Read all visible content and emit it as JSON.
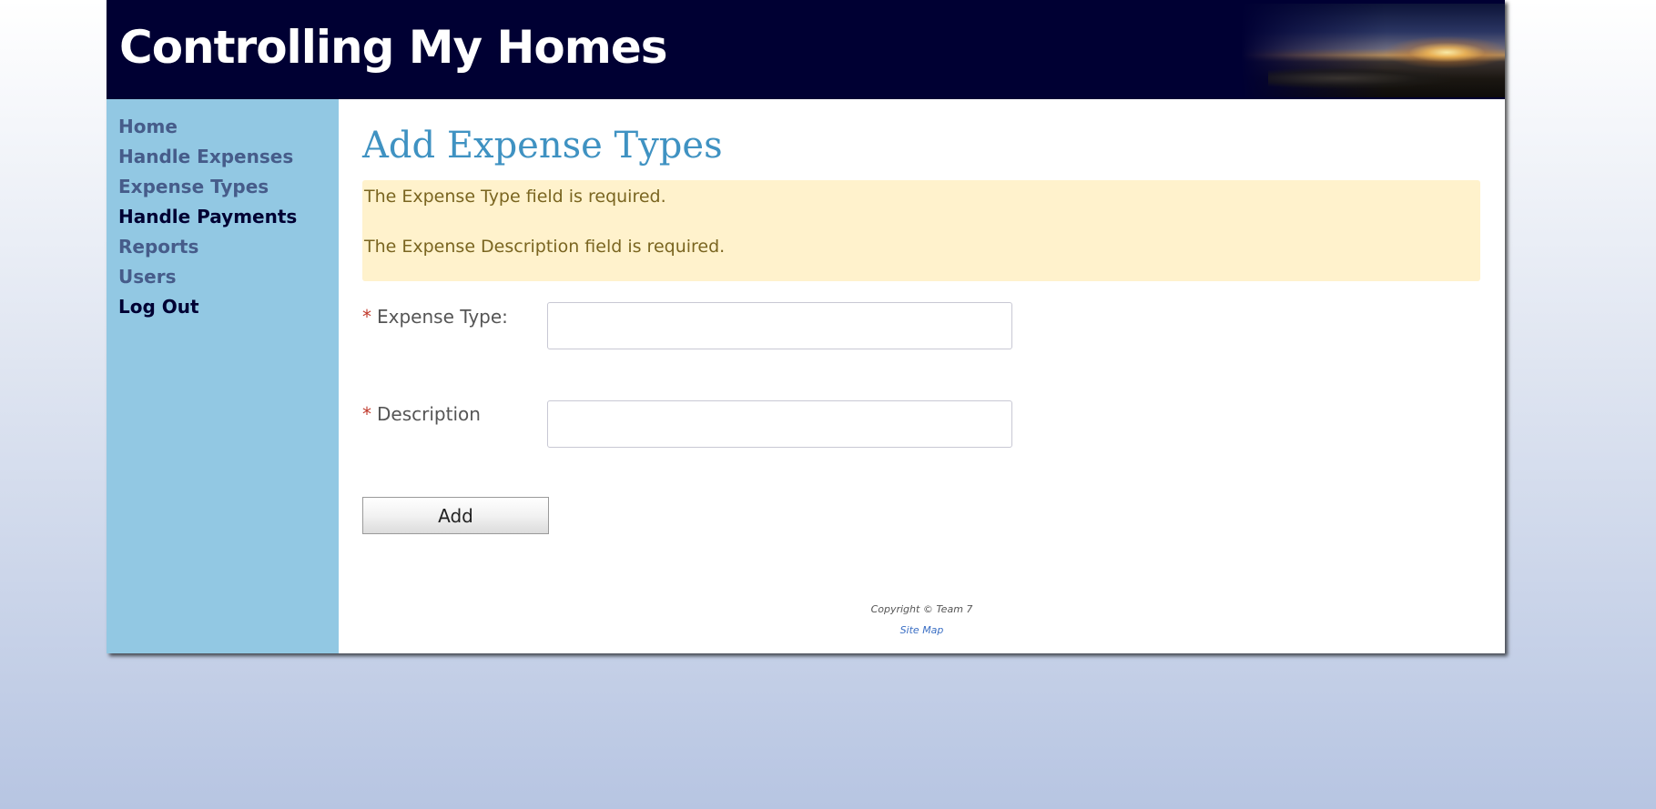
{
  "header": {
    "title": "Controlling My Homes"
  },
  "sidebar": {
    "items": [
      {
        "label": "Home"
      },
      {
        "label": "Handle Expenses"
      },
      {
        "label": "Expense Types"
      },
      {
        "label": "Handle Payments"
      },
      {
        "label": "Reports"
      },
      {
        "label": "Users"
      },
      {
        "label": "Log Out"
      }
    ]
  },
  "main": {
    "heading": "Add Expense Types",
    "errors": [
      "The Expense Type field is required.",
      "The Expense Description field is required."
    ],
    "form": {
      "required_marker": "*",
      "expense_type_label": "Expense Type:",
      "expense_type_value": "",
      "description_label": "Description",
      "description_value": "",
      "submit_label": "Add"
    }
  },
  "footer": {
    "copyright": "Copyright © Team 7",
    "site_map": "Site Map"
  },
  "colors": {
    "header_bg": "#000033",
    "sidebar_bg": "#92c8e3",
    "heading": "#3f92c2",
    "error_bg": "#fff2cc",
    "error_text": "#7a6520",
    "required_marker": "#c0392b"
  },
  "icons": [
    "header-sunset-image"
  ]
}
